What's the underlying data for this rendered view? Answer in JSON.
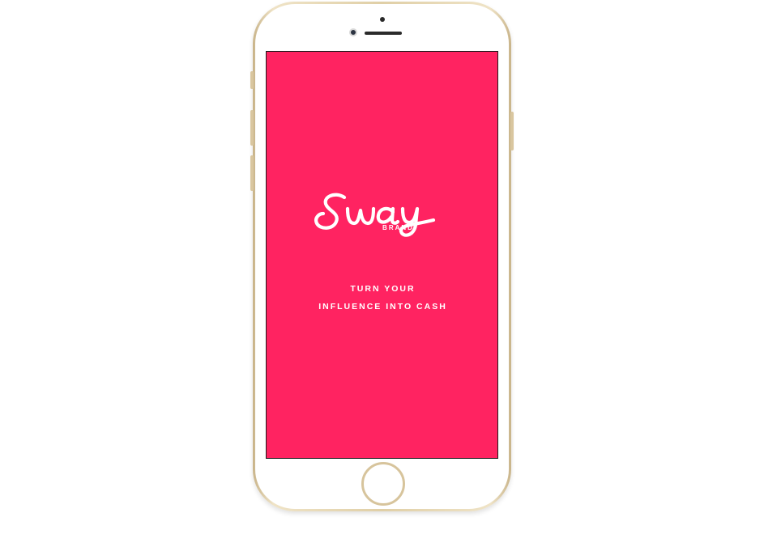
{
  "app": {
    "logo_text": "Sway",
    "logo_subtext": "BRAND",
    "tagline_line1": "TURN YOUR",
    "tagline_line2": "INFLUENCE INTO CASH"
  },
  "colors": {
    "screen_background": "#ff2361",
    "text": "#ffffff",
    "device_frame": "gold"
  },
  "icons": {
    "front_camera": "camera-icon",
    "home_button": "home-button-icon"
  }
}
